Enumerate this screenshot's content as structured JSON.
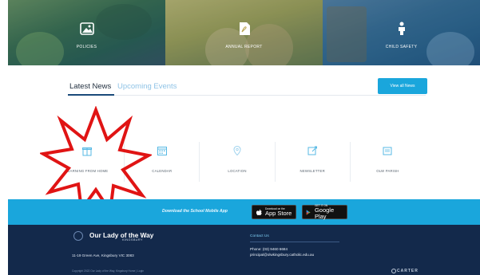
{
  "tiles": [
    {
      "label": "POLICIES",
      "icon": "image-icon"
    },
    {
      "label": "ANNUAL REPORT",
      "icon": "pdf-icon"
    },
    {
      "label": "CHILD SAFETY",
      "icon": "child-icon"
    }
  ],
  "news": {
    "tab_active": "Latest News",
    "tab_inactive": "Upcoming Events",
    "view_all": "View all News"
  },
  "quick_links": [
    {
      "label": "LEARNING FROM HOME",
      "icon": "gift-icon"
    },
    {
      "label": "CALENDAR",
      "icon": "calendar-icon"
    },
    {
      "label": "LOCATION",
      "icon": "map-pin-icon"
    },
    {
      "label": "NEWSLETTER",
      "icon": "newsletter-icon"
    },
    {
      "label": "OLW PARISH",
      "icon": "parish-icon"
    }
  ],
  "app_strip": {
    "text": "Download the School Mobile App",
    "apple_small": "Download on the",
    "apple_big": "App Store",
    "google_small": "GET IT ON",
    "google_big": "Google Play"
  },
  "footer": {
    "school_name": "Our Lady of the Way",
    "school_sub": "KINGSBURY",
    "address": "11-19 Green Ave, Kingsbury VIC 3083",
    "copyright": "Copyright 2022 Our Lady of the Way, Kingsbury   Home  |  Login",
    "contact_title": "Contact Us",
    "phone": "Phone: (03) 9460 6684",
    "email": "principal@olwkingsbury.catholic.edu.au",
    "carter": "CARTER"
  },
  "colors": {
    "accent": "#1aa6dc",
    "footer": "#13294b",
    "annotation": "#e01414"
  }
}
